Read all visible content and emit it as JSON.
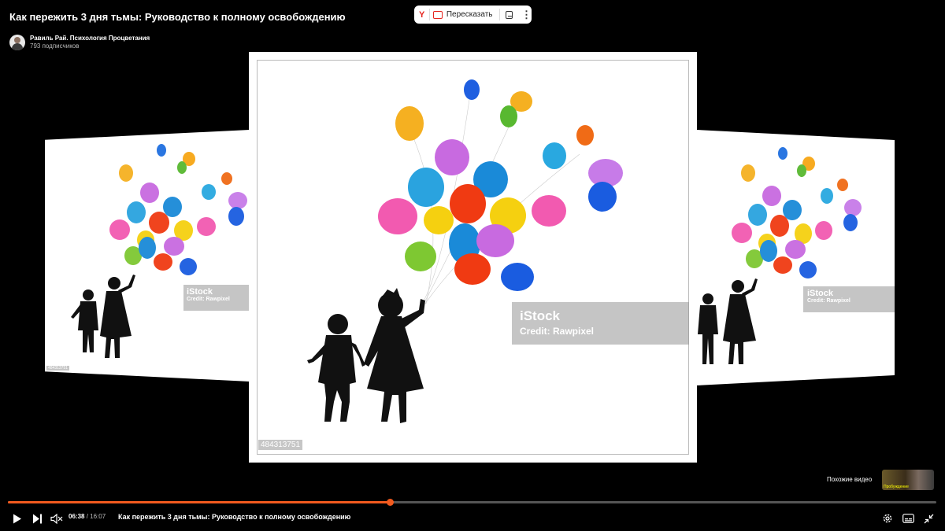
{
  "video": {
    "title": "Как пережить 3 дня тьмы: Руководство к полному освобождению",
    "current_time": "06:38",
    "separator": "/",
    "duration": "16:07",
    "progress_fraction": 0.412
  },
  "channel": {
    "name": "Равиль Рай. Психология Процветания",
    "subscribers": "793 подписчиков"
  },
  "yandex_toolbar": {
    "logo": "Y",
    "retell_label": "Пересказать",
    "icons": [
      "yandex-logo",
      "retell-icon",
      "subtitles-icon",
      "more-icon"
    ]
  },
  "frame_content": {
    "watermark_brand": "iStock",
    "watermark_credit": "Credit: Rawpixel",
    "image_id": "484313751",
    "image_id_small": "484313751"
  },
  "similar": {
    "label": "Похожие видео",
    "thumb_caption": "Пробуждение"
  },
  "controls": {
    "icons": [
      "play-icon",
      "next-icon",
      "mute-icon",
      "settings-icon",
      "subtitles-icon",
      "exit-fullscreen-icon"
    ]
  },
  "colors": {
    "accent": "#f25a1e",
    "yandex_red": "#e52620",
    "background": "#000000"
  }
}
